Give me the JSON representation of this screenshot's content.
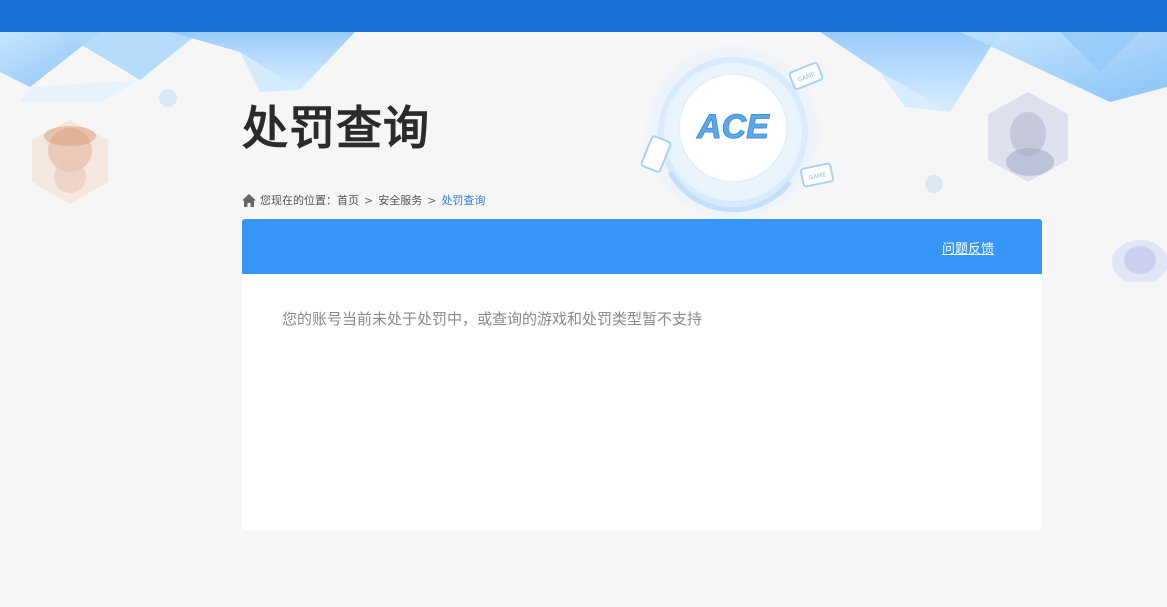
{
  "header": {
    "title": "处罚查询"
  },
  "breadcrumb": {
    "prefix": "您现在的位置：",
    "items": [
      "首页",
      "安全服务",
      "处罚查询"
    ],
    "separator": ">"
  },
  "banner": {
    "logo_text": "ACE",
    "badge_text": "GAME"
  },
  "panel": {
    "feedback_label": "问题反馈",
    "message": "您的账号当前未处于处罚中，或查询的游戏和处罚类型暂不支持"
  },
  "colors": {
    "topbar": "#1873d6",
    "panel_header": "#3796fa",
    "breadcrumb_current": "#2d7fd0",
    "page_bg": "#f6f6f7"
  }
}
